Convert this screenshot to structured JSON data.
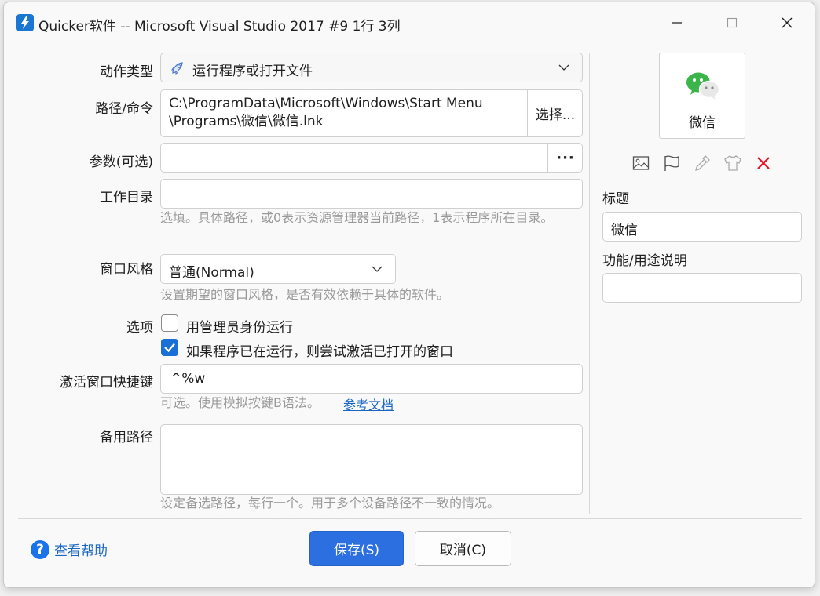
{
  "window": {
    "title": "Quicker软件 -- Microsoft Visual Studio 2017 #9 1行 3列"
  },
  "form": {
    "action_type": {
      "label": "动作类型",
      "value": "运行程序或打开文件"
    },
    "path": {
      "label": "路径/命令",
      "value_line1": "C:\\ProgramData\\Microsoft\\Windows\\Start Menu",
      "value_line2": "\\Programs\\微信\\微信.lnk",
      "browse_label": "选择..."
    },
    "params": {
      "label": "参数(可选)",
      "value": "",
      "more_label": "···"
    },
    "workdir": {
      "label": "工作目录",
      "value": "",
      "hint": "选填。具体路径，或0表示资源管理器当前路径，1表示程序所在目录。"
    },
    "window_style": {
      "label": "窗口风格",
      "value": "普通(Normal)",
      "hint": "设置期望的窗口风格，是否有效依赖于具体的软件。"
    },
    "options": {
      "label": "选项",
      "items": [
        {
          "label": "用管理员身份运行",
          "checked": false
        },
        {
          "label": "如果程序已在运行，则尝试激活已打开的窗口",
          "checked": true
        }
      ]
    },
    "hotkey": {
      "label": "激活窗口快捷键",
      "value": "^%w",
      "hint": "可选。使用模拟按键B语法。",
      "link": "参考文档"
    },
    "backup_path": {
      "label": "备用路径",
      "value": "",
      "hint": "设定备选路径，每行一个。用于多个设备路径不一致的情况。"
    }
  },
  "side": {
    "preview_label": "微信",
    "tools": [
      "image-icon",
      "flag-icon",
      "eyedropper-icon",
      "tshirt-icon",
      "delete-icon"
    ],
    "title_label": "标题",
    "title_value": "微信",
    "desc_label": "功能/用途说明",
    "desc_value": ""
  },
  "footer": {
    "help_label": "查看帮助",
    "save_label": "保存(S)",
    "cancel_label": "取消(C)"
  },
  "colors": {
    "accent": "#2b6fe0",
    "link": "#1a66c2",
    "close_red": "#e81123",
    "wechat_green": "#3bb44a"
  }
}
